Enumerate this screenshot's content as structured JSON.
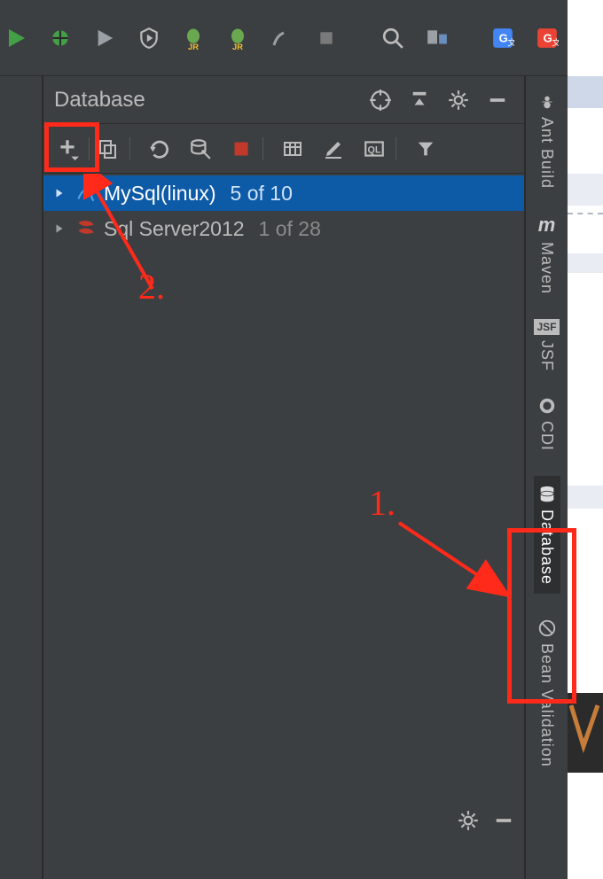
{
  "toolbar": {
    "icons": [
      "run",
      "debug",
      "play",
      "shield",
      "bug-jr-1",
      "bug-jr-2",
      "wand",
      "stop",
      "search",
      "attach",
      "translate-g",
      "translate-g2"
    ]
  },
  "panel": {
    "title": "Database",
    "header_icons": [
      "target",
      "minimize-split",
      "settings",
      "hide"
    ],
    "toolbar_icons": [
      "add",
      "copy",
      "refresh",
      "wrench",
      "stop-red",
      "table",
      "edit",
      "ql",
      "filter"
    ]
  },
  "tree": [
    {
      "name": "MySql(linux)",
      "count": "5 of 10",
      "selected": true,
      "icon": "mysql"
    },
    {
      "name": "Sql Server2012",
      "count": "1 of 28",
      "selected": false,
      "icon": "mssql"
    }
  ],
  "right_bar": [
    {
      "label": "Ant Build",
      "icon": "ant"
    },
    {
      "label": "Maven",
      "icon": "maven"
    },
    {
      "label": "JSF",
      "icon": "jsf"
    },
    {
      "label": "CDI",
      "icon": "cdi"
    },
    {
      "label": "Database",
      "icon": "database",
      "active": true
    },
    {
      "label": "Bean Validation",
      "icon": "bean"
    }
  ],
  "annotations": {
    "label1": "1.",
    "label2": "2."
  },
  "colors": {
    "bg": "#3c3f41",
    "selection": "#0d5aa7",
    "highlight": "#ff2a1a"
  }
}
